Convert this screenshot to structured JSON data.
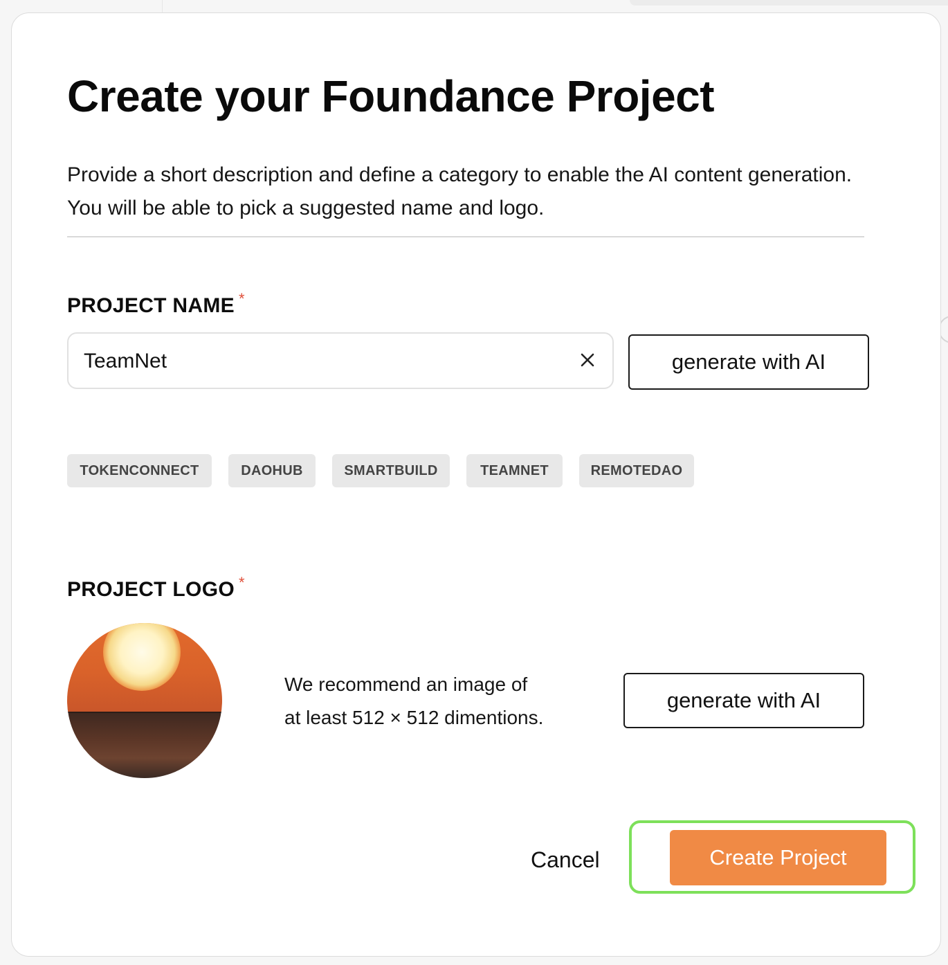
{
  "modal": {
    "title": "Create your Foundance Project",
    "description": "Provide a short description and define a category to enable the AI content generation. You will be able to pick a suggested name and logo."
  },
  "project_name": {
    "label": "PROJECT NAME",
    "required_marker": "*",
    "value": "TeamNet",
    "generate_label": "generate with AI",
    "clear_icon": "close-icon",
    "suggestions": [
      "TOKENCONNECT",
      "DAOHUB",
      "SMARTBUILD",
      "TEAMNET",
      "REMOTEDAO"
    ]
  },
  "project_logo": {
    "label": "PROJECT LOGO",
    "required_marker": "*",
    "recommendation_line1": "We recommend an image of",
    "recommendation_line2": "at least 512 × 512 dimentions.",
    "generate_label": "generate with AI"
  },
  "footer": {
    "cancel_label": "Cancel",
    "create_label": "Create Project"
  },
  "colors": {
    "accent": "#f08a45",
    "focus_ring": "#7de05a",
    "required": "#e0503a",
    "chip_bg": "#e8e8e8"
  }
}
